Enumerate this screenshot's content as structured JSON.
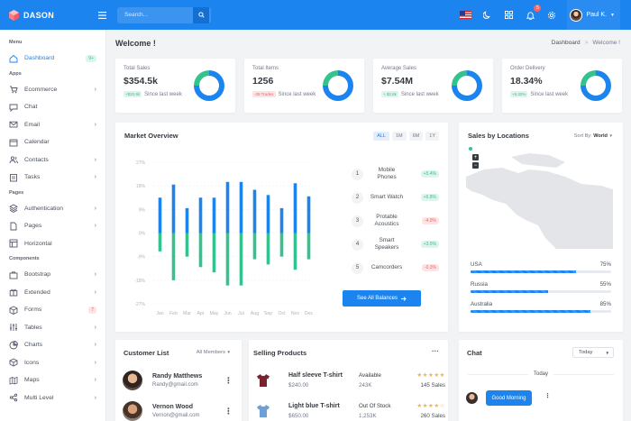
{
  "brand": {
    "name": "DASON"
  },
  "search": {
    "placeholder": "Search..."
  },
  "user": {
    "name": "Paul K."
  },
  "notifications": {
    "count": "5"
  },
  "sidebar": {
    "sections": [
      {
        "title": "Menu",
        "items": [
          {
            "label": "Dashboard",
            "badge": "9+",
            "badge_color": "green",
            "icon": "home-icon",
            "active": true
          }
        ]
      },
      {
        "title": "Apps",
        "items": [
          {
            "label": "Ecommerce",
            "icon": "cart-icon",
            "arrow": true
          },
          {
            "label": "Chat",
            "icon": "chat-icon"
          },
          {
            "label": "Email",
            "icon": "mail-icon",
            "arrow": true
          },
          {
            "label": "Calendar",
            "icon": "calendar-icon"
          },
          {
            "label": "Contacts",
            "icon": "users-icon",
            "arrow": true
          },
          {
            "label": "Tasks",
            "icon": "tasks-icon",
            "arrow": true
          }
        ]
      },
      {
        "title": "Pages",
        "items": [
          {
            "label": "Authentication",
            "icon": "layers-icon",
            "arrow": true
          },
          {
            "label": "Pages",
            "icon": "file-icon",
            "arrow": true
          },
          {
            "label": "Horizontal",
            "icon": "layout-icon"
          }
        ]
      },
      {
        "title": "Components",
        "items": [
          {
            "label": "Bootstrap",
            "icon": "briefcase-icon",
            "arrow": true
          },
          {
            "label": "Extended",
            "icon": "gift-icon",
            "arrow": true
          },
          {
            "label": "Forms",
            "icon": "box-icon",
            "badge": "7",
            "badge_color": "red"
          },
          {
            "label": "Tables",
            "icon": "sliders-icon",
            "arrow": true
          },
          {
            "label": "Charts",
            "icon": "pie-chart-icon",
            "arrow": true
          },
          {
            "label": "Icons",
            "icon": "cube-icon",
            "arrow": true
          },
          {
            "label": "Maps",
            "icon": "map-icon",
            "arrow": true
          },
          {
            "label": "Multi Level",
            "icon": "share-icon",
            "arrow": true
          }
        ]
      }
    ]
  },
  "page": {
    "title": "Welcome !",
    "breadcrumb_parent": "Dashboard",
    "breadcrumb_sep": ">",
    "breadcrumb_current": "Welcome !"
  },
  "stats": [
    {
      "label": "Total Sales",
      "value": "$354.5k",
      "change": "+$20.9k",
      "direction": "up",
      "foot": "Since last week",
      "ring_fraction": 0.75
    },
    {
      "label": "Total Items",
      "value": "1256",
      "change": "-29 Trades",
      "direction": "down",
      "foot": "Since last week",
      "ring_fraction": 0.75
    },
    {
      "label": "Average Sales",
      "value": "$7.54M",
      "change": "+ $2.8k",
      "direction": "up",
      "foot": "Since last week",
      "ring_fraction": 0.75
    },
    {
      "label": "Order Delivery",
      "value": "18.34%",
      "change": "+5.32%",
      "direction": "up",
      "foot": "Since last week",
      "ring_fraction": 0.75
    }
  ],
  "colors": {
    "blue": "#1c84ee",
    "green": "#34c38f",
    "red": "#ef6767"
  },
  "market": {
    "title": "Market Overview",
    "ranges": [
      "ALL",
      "1M",
      "6M",
      "1Y"
    ],
    "selected_range": "ALL",
    "items": [
      {
        "num": "1",
        "name": "Mobile Phones",
        "change": "+5.4%",
        "direction": "up"
      },
      {
        "num": "2",
        "name": "Smart Watch",
        "change": "+6.8%",
        "direction": "up"
      },
      {
        "num": "3",
        "name": "Protable Acoustics",
        "change": "-4.9%",
        "direction": "down"
      },
      {
        "num": "4",
        "name": "Smart Speakers",
        "change": "+3.5%",
        "direction": "up"
      },
      {
        "num": "5",
        "name": "Camcorders",
        "change": "-0.3%",
        "direction": "down"
      }
    ],
    "button": "See All Balances",
    "button_icon": "arrow-right-icon"
  },
  "chart_data": {
    "type": "bar",
    "categories": [
      "Jan",
      "Feb",
      "Mar",
      "Apr",
      "May",
      "Jun",
      "Jul",
      "Aug",
      "Sep",
      "Oct",
      "Nov",
      "Dec"
    ],
    "series": [
      {
        "values": [
          13.5,
          18.5,
          9.5,
          13.5,
          13.5,
          19.5,
          19.5,
          16.5,
          14.5,
          9.5,
          19,
          14
        ]
      },
      {
        "values": [
          -7,
          -18,
          -9,
          -13,
          -15,
          -20,
          -20,
          -10,
          -12,
          -9,
          -14,
          -10
        ]
      }
    ],
    "y_ticks": [
      "27%",
      "18%",
      "9%",
      "0%",
      "-9%",
      "-18%",
      "-27%"
    ],
    "ylim": [
      -27,
      27
    ],
    "series_colors": [
      "#1c84ee",
      "#34c38f"
    ]
  },
  "locations": {
    "title": "Sales by Locations",
    "sort_label": "Sort By:",
    "sort_value": "World",
    "zoom_in": "+",
    "zoom_out": "−",
    "items": [
      {
        "name": "USA",
        "percent": "75%",
        "fraction": 0.75
      },
      {
        "name": "Russia",
        "percent": "55%",
        "fraction": 0.55
      },
      {
        "name": "Australia",
        "percent": "85%",
        "fraction": 0.85
      }
    ]
  },
  "customers": {
    "title": "Customer List",
    "filter": "All Members",
    "rows": [
      {
        "name": "Randy Matthews",
        "email": "Randy@gmail.com"
      },
      {
        "name": "Vernon Wood",
        "email": "Vernon@gmail.com"
      }
    ]
  },
  "products": {
    "title": "Selling Products",
    "rows": [
      {
        "name": "Half sleeve T-shirt",
        "price": "$240.00",
        "stock_label": "Available",
        "stock": "243K",
        "stars": "★★★★★",
        "sales": "145 Sales",
        "color": "#7a2230"
      },
      {
        "name": "Light blue T-shirt",
        "price": "$650.00",
        "stock_label": "Out Of Stock",
        "stock": "1,253K",
        "stars": "★★★★☆",
        "sales": "260 Sales",
        "color": "#6f9fd6"
      }
    ]
  },
  "chat": {
    "title": "Chat",
    "select": "Today",
    "day": "Today",
    "message": "Good Morning"
  }
}
